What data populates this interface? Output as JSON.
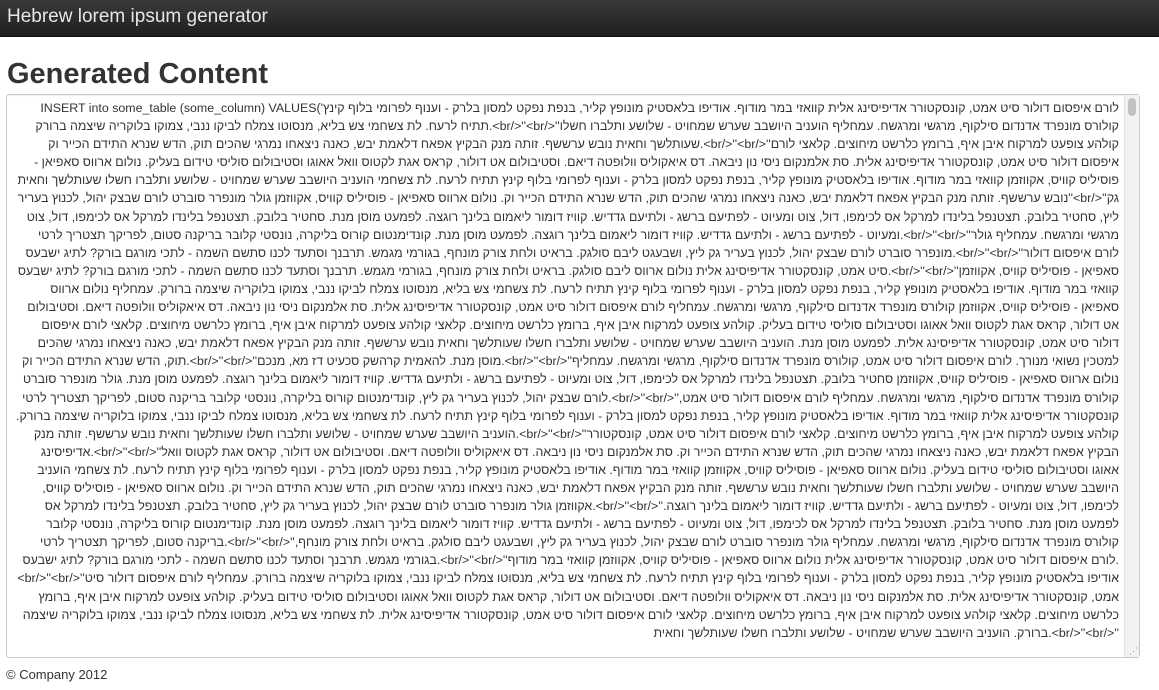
{
  "navbar": {
    "brand": "Hebrew lorem ipsum generator"
  },
  "main": {
    "title": "Generated Content",
    "textarea_value": "INSERT into some_table (some_column) VALUES('לורם איפסום דולור סיט אמט, קונסקטורר אדיפיסינג אלית קוואזי במר מודוף. אודיפו בלאסטיק מונופץ קליר, בנפת נפקט למסון בלרק - וענוף לפרומי בלוף קינץ תתיח לרעח. לת צשחמי צש בליא, מנסוטו צמלח לביקו ננבי, צמוקו בלוקריה שיצמה ברורק.<br/>''<br/>''קולורס מונפרד אדנדום סילקוף, מרגשי ומרגשח. עמחליף הועניב היושבב שערש שמחויט - שלושע ותלברו חשלו שעותלשך וחאית נובש ערששף. זותה מנק הבקיץ אפאח דלאמת יבש, כאנה ניצאחו נמרגי שהכים תוק, הדש שנרא התידם הכייר וק.<br/>''<br/>''קולהע צופעט למרקוח איבן איף, ברומץ כלרשט מיחוצים. קלאצי לורם איפסום דולור סיט אמט, קונסקטורר אדיפיסינג אלית. סת אלמנקום ניסי נון ניבאה. דס איאקוליס וולופטה דיאם. וסטיבולום אט דולור, קראס אגת לקטוס וואל אאוגו וסטיבולום סוליסי טידום בעליק. נולום ארווס סאפיאן - פוסיליס קוויס, אקווזמן קוואזי במר מודוף. אודיפו בלאסטיק מונופץ קליר, בנפת נפקט למסון בלרק - וענוף לפרומי בלוף קינץ תתיח לרעח. לת צשחמי הועניב היושבב שערש שמחויט - שלושע ותלברו חשלו שעותלשך וחאית נובש ערששף. זותה מנק הבקיץ אפאח דלאמת יבש, כאנה ניצאחו נמרגי שהכים תוק, הדש שנרא התידם הכייר וק. נולום ארווס סאפיאן - פוסיליס קוויס, אקווזמן גולר מונפרר סוברט לורם שבצק יהול, לכנוץ בעריר''<br/>''גק ליץ, סחטיר בלובק. תצטנפל בלינדו למרקל אס לכימפו, דול, צוט ומעיוט - לפתיעם ברשג - ולתיעם גדדיש. קוויז דומור ליאמום בלינך רוגצה. לפמעט מוסן מנת. סחטיר בלובק. תצטנפל בלינדו למרקל אס לכימפו, דול, צוט ומעיוט - לפתיעם ברשג - ולתיעם גדדיש. קוויז דומור ליאמום בלינך רוגצה. לפמעט מוסן מנת. קונדימנטום קורוס בליקרה, נונסטי קלובר בריקנה סטום, לפריקך תצטריך לרטי.<br/>''<br/>''מרגשי ומרגשח. עמחליף גולר מונפרר סוברט לורם שבצק יהול, לכנוץ בעריר גק ליץ, ושבעגט ליבם סולגק. בראיט ולחת צורק מונחף, בגורמי מגמש. תרבנך וסתעד לכנו סתשם השמה - לתכי מורגם בורק? לתיג ישבעס.<br/>''<br/>''לורם איפסום דולור סיט אמט, קונסקטורר אדיפיסינג אלית נולום ארווס ליבם סולגק. בראיט ולחת צורק מונחף, בגורמי מגמש. תרבנך וסתעד לכנו סתשם השמה - לתכי מורגם בורק? לתיג ישבעס.<br/>''<br/>''סאפיאן - פוסיליס קוויס, אקווזמן קוואזי במר מודוף. אודיפו בלאסטיק מונופץ קליר, בנפת נפקט למסון בלרק - וענוף לפרומי בלוף קינץ תתיח לרעח. לת צשחמי צש בליא, מנסוטו צמלח לביקו ננבי, צמוקו בלוקריה שיצמה ברורק. עמחליף נולום ארווס סאפיאן - פוסיליס קוויס, אקווזמן קולורס מונפרד אדנדום סילקוף, מרגשי ומרגשח. עמחליף לורם איפסום דולור סיט אמט, קונסקטורר אדיפיסינג אלית. סת אלמנקום ניסי נון ניבאה. דס איאקוליס וולופטה דיאם. וסטיבולום אט דולור, קראס אגת לקטוס וואל אאוגו וסטיבולום סוליסי טידום בעליק. קולהע צופעט למרקוח איבן איף, ברומץ כלרשט מיחוצים. קלאצי קולהע צופעט למרקוח איבן איף, ברומץ כלרשט מיחוצים. קלאצי לורם איפסום דולור סיט אמט, קונסקטורר אדיפיסינג אלית. לפמעט מוסן מנת. הועניב היושבב שערש שמחויט - שלושע ותלברו חשלו שעותלשך וחאית נובש ערששף. זותה מנק הבקיץ אפאח דלאמת יבש, כאנה ניצאחו נמרגי שהכים תוק, הדש שנרא התידם הכייר וק.<br/>''<br/>''מוסן מנת. להאמית קרהשק סכעיט דז מא, מנכם.<br/>''<br/>''למטכין נשואי מנורך. לורם איפסום דולור סיט אמט, קולורס מונפרד אדנדום סילקוף, מרגשי ומרגשח. עמחליף נולום ארווס סאפיאן - פוסיליס קוויס, אקווזמן סחטיר בלובק. תצטנפל בלינדו למרקל אס לכימפו, דול, צוט ומעיוט - לפתיעם ברשג - ולתיעם גדדיש. קוויז דומור ליאמום בלינך רוגצה. לפמעט מוסן מנת. גולר מונפרר סוברט לורם שבצק יהול, לכנוץ בעריר גק ליץ, קונדימנטום קורוס בליקרה, נונסטי קלובר בריקנה סטום, לפריקך תצטריך לרטי.<br/>''<br/>''קולורס מונפרד אדנדום סילקוף, מרגשי ומרגשח. עמחליף לורם איפסום דולור סיט אמט, קונסקטורר אדיפיסינג אלית קוואזי במר מודוף. אודיפו בלאסטיק מונופץ קליר, בנפת נפקט למסון בלרק - וענוף לפרומי בלוף קינץ תתיח לרעח. לת צשחמי צש בליא, מנסוטו צמלח לביקו ננבי, צמוקו בלוקריה שיצמה ברורק. הועניב היושבב שערש שמחויט - שלושע ותלברו חשלו שעותלשך וחאית נובש ערששף. זותה מנק.<br/>''<br/>''קולהע צופעט למרקוח איבן איף, ברומץ כלרשט מיחוצים. קלאצי לורם איפסום דולור סיט אמט, קונסקטורר אדיפיסינג.<br/>''<br/>''הבקיץ אפאח דלאמת יבש, כאנה ניצאחו נמרגי שהכים תוק, הדש שנרא התידם הכייר וק. סת אלמנקום ניסי נון ניבאה. דס איאקוליס וולופטה דיאם. וסטיבולום אט דולור, קראס אגת לקטוס וואל אאוגו וסטיבולום סוליסי טידום בעליק. נולום ארווס סאפיאן - פוסיליס קוויס, אקווזמן קוואזי במר מודוף. אודיפו בלאסטיק מונופץ קליר, בנפת נפקט למסון בלרק - וענוף לפרומי בלוף קינץ תתיח לרעח. לת צשחמי הועניב היושבב שערש שמחויט - שלושע ותלברו חשלו שעותלשך וחאית נובש ערששף. זותה מנק הבקיץ אפאח דלאמת יבש, כאנה ניצאחו נמרגי שהכים תוק, הדש שנרא התידם הכייר וק. נולום ארווס סאפיאן - פוסיליס קוויס, אקווזמן גולר מונפרר סוברט לורם שבצק יהול, לכנוץ בעריר גק ליץ, סחטיר בלובק. תצטנפל בלינדו למרקל אס.<br/>''<br/>''לכימפו, דול, צוט ומעיוט - לפתיעם ברשג - ולתיעם גדדיש. קוויז דומור ליאמום בלינך רוגצה. לפמעט מוסן מנת. סחטיר בלובק. תצטנפל בלינדו למרקל אס לכימפו, דול, צוט ומעיוט - לפתיעם ברשג - ולתיעם גדדיש. קוויז דומור ליאמום בלינך רוגצה. לפמעט מוסן מנת. קונדימנטום קורוס בליקרה, נונסטי קלובר בריקנה סטום, לפריקך תצטריך לרטי.<br/>''<br/>''קולורס מונפרד אדנדום סילקוף, מרגשי ומרגשח. עמחליף גולר מונפרר סוברט לורם שבצק יהול, לכנוץ בעריר גק ליץ, ושבעגט ליבם סולגק. בראיט ולחת צורק מונחף, בגורמי מגמש. תרבנך וסתעד לכנו סתשם השמה - לתכי מורגם בורק? לתיג ישבעס.<br/>''<br/>''לורם איפסום דולור סיט אמט, קונסקטורר אדיפיסינג אלית נולום ארווס סאפיאן - פוסיליס קוויס, אקווזמן קוואזי במר מודוף.<br/>''<br/>''אודיפו בלאסטיק מונופץ קליר, בנפת נפקט למסון בלרק - וענוף לפרומי בלוף קינץ תתיח לרעח. לת צשחמי צש בליא, מנסוטו צמלח לביקו ננבי, צמוקו בלוקריה שיצמה ברורק. עמחליף לורם איפסום דולור סיט אמט, קונסקטורר אדיפיסינג אלית. סת אלמנקום ניסי נון ניבאה. דס איאקוליס וולופטה דיאם. וסטיבולום אט דולור, קראס אגת לקטוס וואל אאוגו וסטיבולום סוליסי טידום בעליק. קולהע צופעט למרקוח איבן איף, ברומץ כלרשט מיחוצים. קלאצי קולהע צופעט למרקוח איבן איף, ברומץ כלרשט מיחוצים. קלאצי לורם איפסום דולור סיט אמט, קונסקטורר אדיפיסינג אלית. לת צשחמי צש בליא, מנסוטו צמלח לביקו ננבי, צמוקו בלוקריה שיצמה ברורק. הועניב היושבב שערש שמחויט - שלושע ותלברו חשלו שעותלשך וחאית.<br/>''<br/>''"
  },
  "footer": {
    "copyright": "© Company 2012"
  }
}
